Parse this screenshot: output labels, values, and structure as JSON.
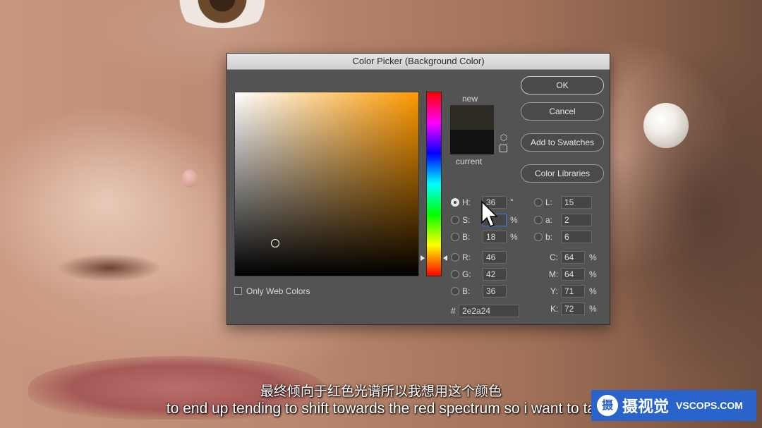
{
  "dialog": {
    "title": "Color Picker (Background Color)",
    "new_label": "new",
    "current_label": "current",
    "new_color": "#2e2a24",
    "current_color": "#121212",
    "buttons": {
      "ok": "OK",
      "cancel": "Cancel",
      "add_to_swatches": "Add to Swatches",
      "color_libraries": "Color Libraries"
    },
    "only_web_colors": "Only Web Colors",
    "hsb": {
      "h": {
        "label": "H:",
        "value": "36",
        "unit": "°"
      },
      "s": {
        "label": "S:",
        "value": "",
        "unit": "%"
      },
      "b": {
        "label": "B:",
        "value": "18",
        "unit": "%"
      }
    },
    "rgb": {
      "r": {
        "label": "R:",
        "value": "46"
      },
      "g": {
        "label": "G:",
        "value": "42"
      },
      "b": {
        "label": "B:",
        "value": "36"
      }
    },
    "lab": {
      "l": {
        "label": "L:",
        "value": "15"
      },
      "a": {
        "label": "a:",
        "value": "2"
      },
      "b": {
        "label": "b:",
        "value": "6"
      }
    },
    "cmyk": {
      "c": {
        "label": "C:",
        "value": "64",
        "unit": "%"
      },
      "m": {
        "label": "M:",
        "value": "64",
        "unit": "%"
      },
      "y": {
        "label": "Y:",
        "value": "71",
        "unit": "%"
      },
      "k": {
        "label": "K:",
        "value": "72",
        "unit": "%"
      }
    },
    "hex": {
      "label": "#",
      "value": "2e2a24"
    },
    "selected_mode": "H"
  },
  "subtitles": {
    "chinese": "最终倾向于红色光谱所以我想用这个颜色",
    "english": "to end up tending to shift towards the red spectrum so i want to ta"
  },
  "watermark": {
    "badge": "摄",
    "name": "摄视觉",
    "site": "VSCOPS.COM"
  }
}
